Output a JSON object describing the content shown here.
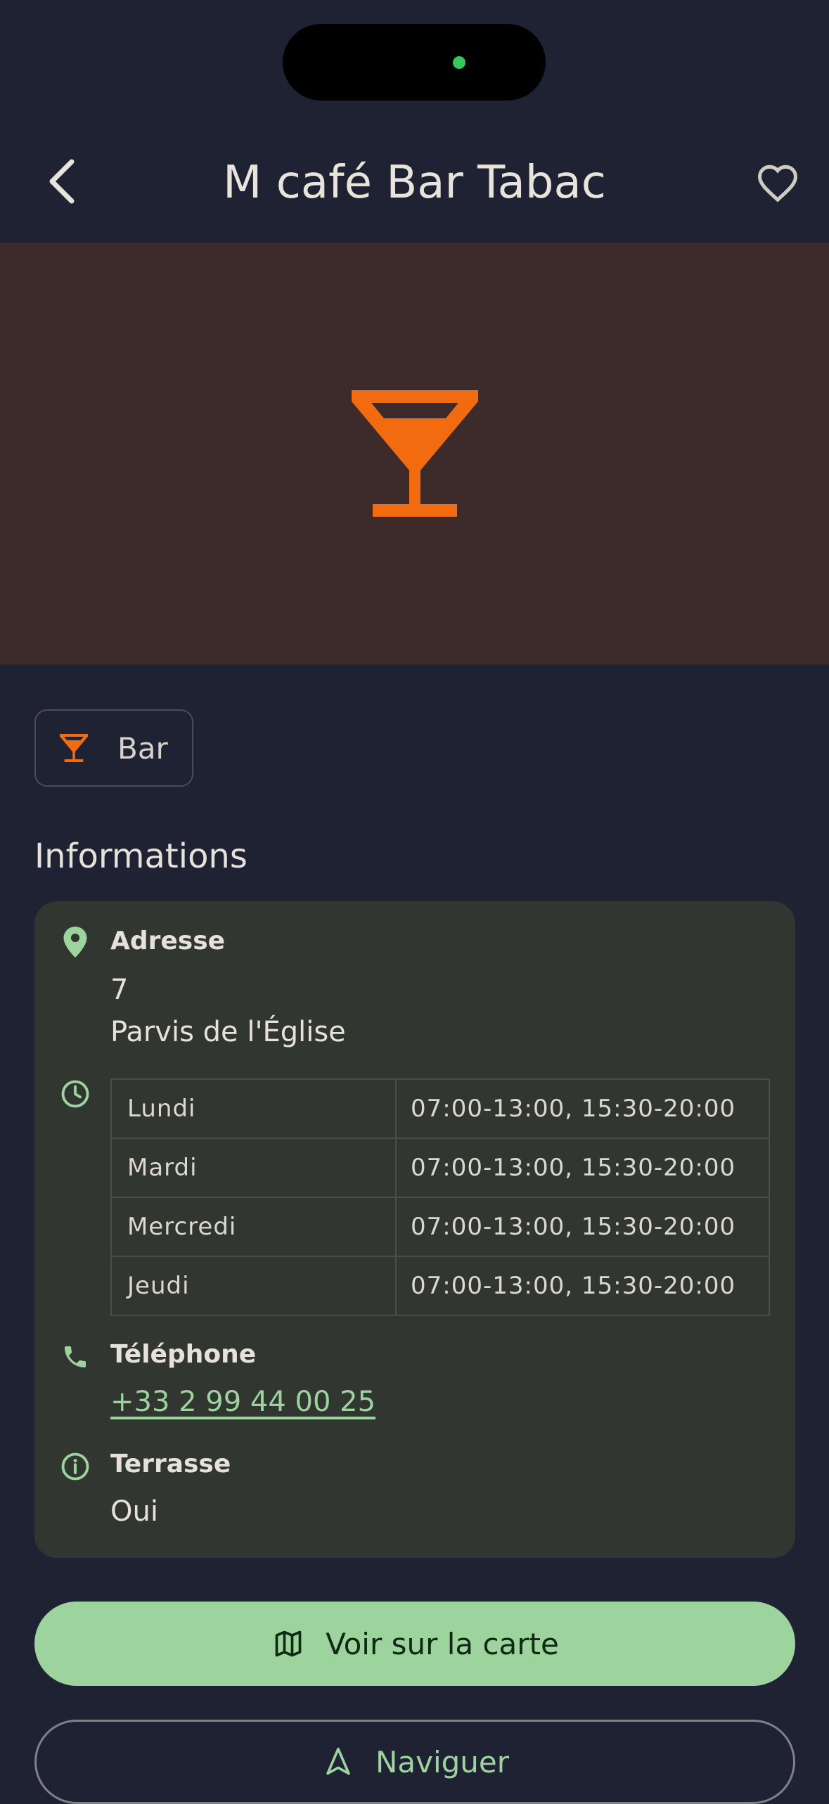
{
  "header": {
    "title": "M café Bar Tabac",
    "back_icon": "chevron-left-icon",
    "favorite_icon": "heart-outline-icon"
  },
  "hero": {
    "icon": "cocktail-glass-icon",
    "accent": "#F26B0F",
    "background": "#3D2B2B"
  },
  "category": {
    "label": "Bar",
    "icon": "cocktail-glass-icon"
  },
  "info": {
    "section_title": "Informations",
    "address": {
      "label": "Adresse",
      "line1": "7",
      "line2": "Parvis de l'Église",
      "icon": "location-pin-icon"
    },
    "hours": {
      "icon": "clock-icon",
      "rows": [
        {
          "day": "Lundi",
          "time": "07:00-13:00, 15:30-20:00"
        },
        {
          "day": "Mardi",
          "time": "07:00-13:00, 15:30-20:00"
        },
        {
          "day": "Mercredi",
          "time": "07:00-13:00, 15:30-20:00"
        },
        {
          "day": "Jeudi",
          "time": "07:00-13:00, 15:30-20:00"
        }
      ]
    },
    "phone": {
      "label": "Téléphone",
      "value": "+33 2 99 44 00 25",
      "icon": "phone-icon"
    },
    "terrace": {
      "label": "Terrasse",
      "value": "Oui",
      "icon": "info-icon"
    }
  },
  "actions": {
    "map_label": "Voir sur la carte",
    "map_icon": "map-icon",
    "navigate_label": "Naviguer",
    "navigate_icon": "navigation-arrow-icon"
  },
  "colors": {
    "background": "#1F2232",
    "card": "#323630",
    "accent_green": "#9DD49E",
    "accent_orange": "#F26B0F"
  }
}
